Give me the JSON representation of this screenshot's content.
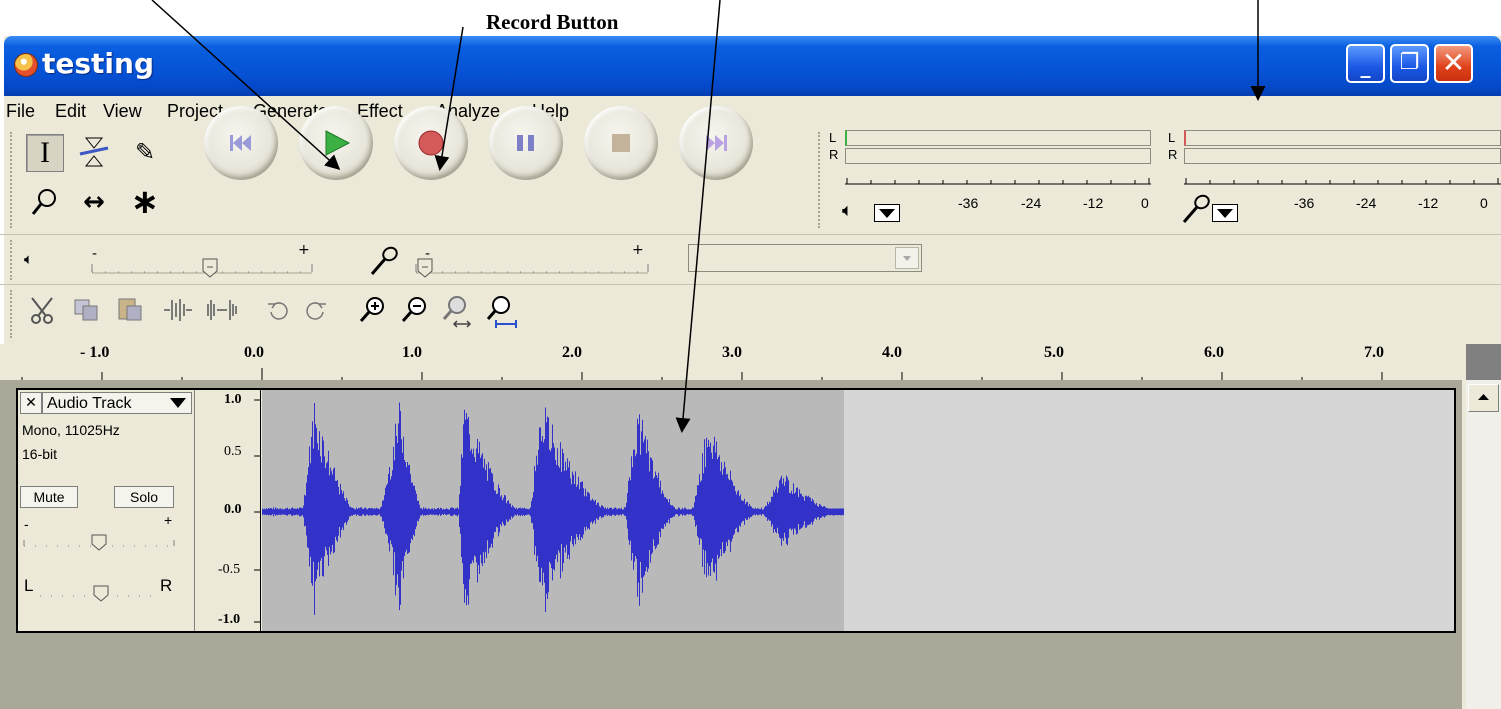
{
  "annotation": {
    "record_label": "Record Button"
  },
  "window": {
    "title": "testing"
  },
  "menu": [
    "File",
    "Edit",
    "View",
    "Project",
    "Generate",
    "Effect",
    "Analyze",
    "Help"
  ],
  "tools": [
    "selection-tool",
    "envelope-tool",
    "draw-tool",
    "zoom-tool",
    "time-shift-tool",
    "multi-tool"
  ],
  "transport": [
    "skip-to-start",
    "play",
    "record",
    "pause",
    "stop",
    "skip-to-end"
  ],
  "meters": {
    "play": {
      "channel_l": "L",
      "channel_r": "R",
      "ticks": [
        "-36",
        "-24",
        "-12",
        "0"
      ]
    },
    "record": {
      "channel_l": "L",
      "channel_r": "R",
      "ticks": [
        "-36",
        "-24",
        "-12",
        "0"
      ]
    }
  },
  "mixer": {
    "minus": "-",
    "plus": "+",
    "input_select_value": ""
  },
  "ruler": {
    "ticks": [
      "- 1.0",
      "0.0",
      "1.0",
      "2.0",
      "3.0",
      "4.0",
      "5.0",
      "6.0",
      "7.0"
    ]
  },
  "track": {
    "close": "✕",
    "name": "Audio Track",
    "format": "Mono, 11025Hz",
    "bit_depth": "16-bit",
    "mute": "Mute",
    "solo": "Solo",
    "gain_minus": "-",
    "gain_plus": "+",
    "pan_left": "L",
    "pan_right": "R",
    "vertical_scale": [
      "1.0",
      "0.5",
      "0.0",
      "-0.5",
      "-1.0"
    ]
  },
  "colors": {
    "waveform": "#3232c8",
    "title_bar": "#0654d8",
    "play_icon": "#3cb043",
    "record_icon": "#d45a5a"
  }
}
